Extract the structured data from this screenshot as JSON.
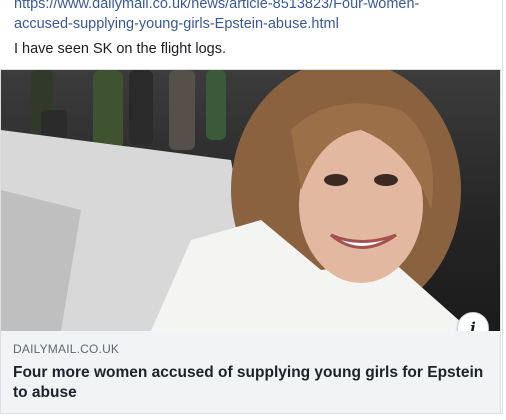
{
  "post": {
    "link_line_1": "https://www.dailymail.co.uk/news/article-8513823/Four-women-",
    "link_line_2": "accused-supplying-young-girls-Epstein-abuse.html",
    "caption": "I have seen SK on the flight logs."
  },
  "link_preview": {
    "domain": "DAILYMAIL.CO.UK",
    "headline": "Four more women accused of supplying young girls for Epstein to abuse",
    "info_icon": "info-icon"
  },
  "colors": {
    "link": "#385898",
    "meta_bg": "#f2f3f5",
    "text": "#1c1e21"
  }
}
